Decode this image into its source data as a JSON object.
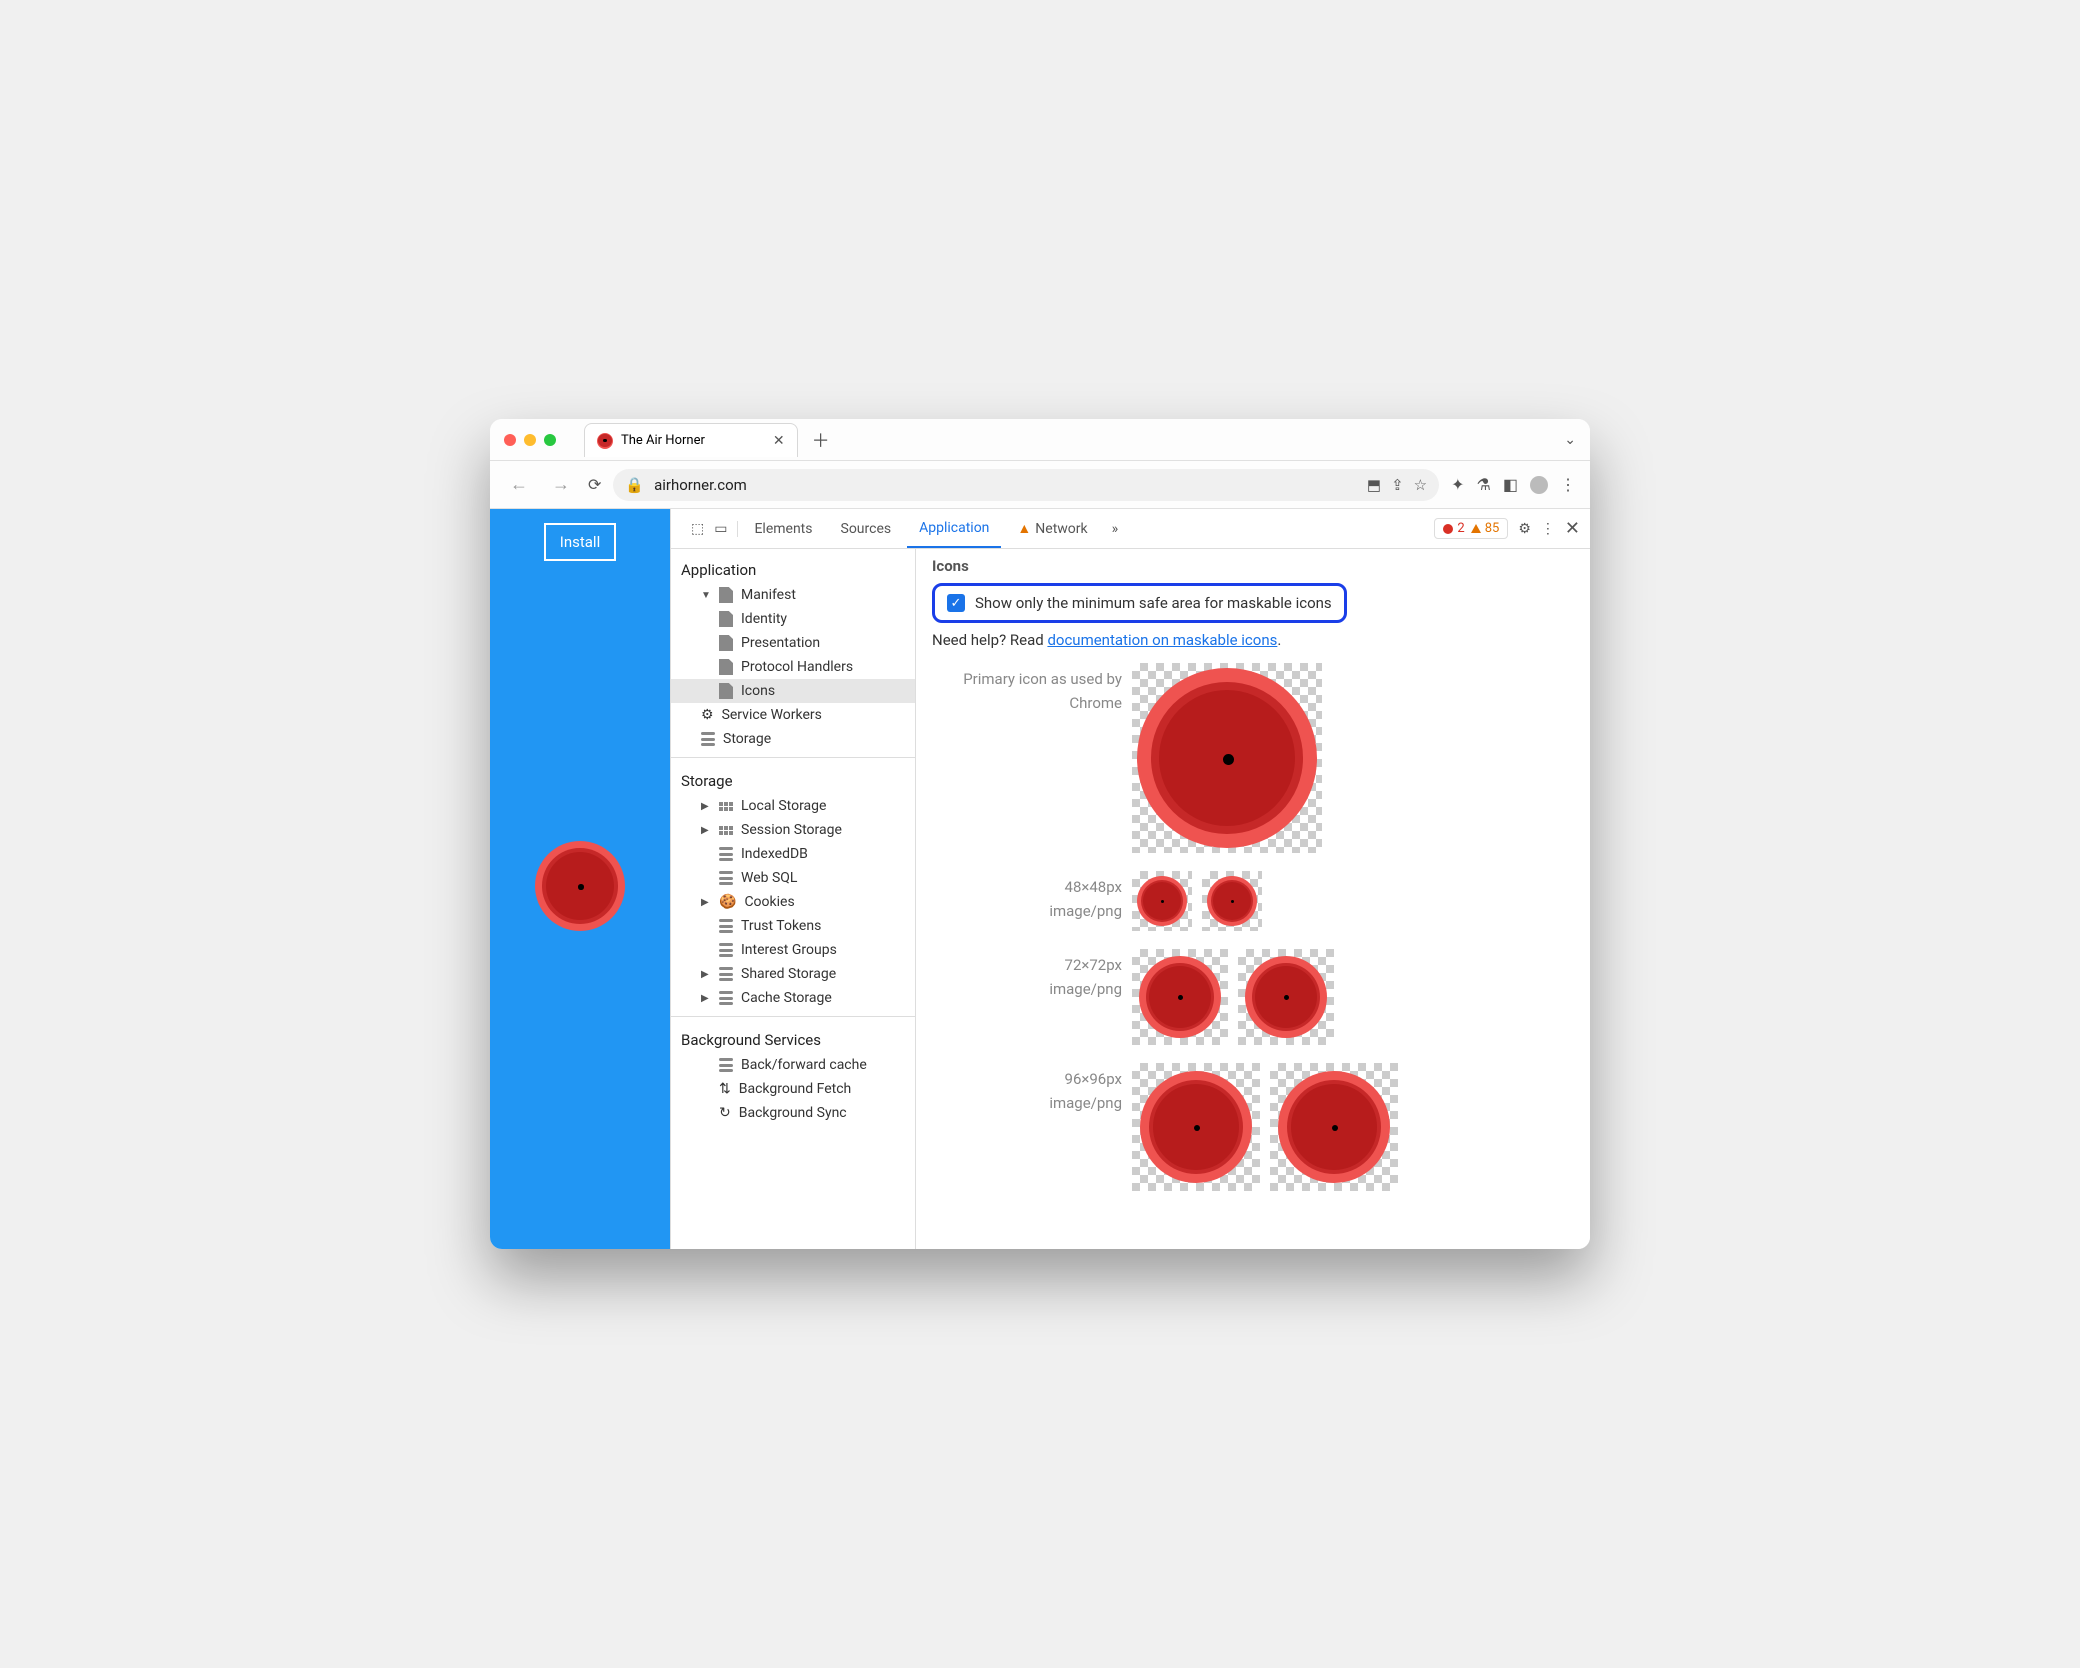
{
  "browser": {
    "tab_title": "The Air Horner",
    "url": "airhorner.com",
    "install_label": "Install"
  },
  "devtools": {
    "tabs": {
      "elements": "Elements",
      "sources": "Sources",
      "application": "Application",
      "network": "Network"
    },
    "issues": {
      "errors": "2",
      "warnings": "85"
    },
    "sidebar": {
      "application": "Application",
      "manifest": "Manifest",
      "identity": "Identity",
      "presentation": "Presentation",
      "protocol_handlers": "Protocol Handlers",
      "icons": "Icons",
      "service_workers": "Service Workers",
      "storage_app": "Storage",
      "storage": "Storage",
      "local_storage": "Local Storage",
      "session_storage": "Session Storage",
      "indexeddb": "IndexedDB",
      "websql": "Web SQL",
      "cookies": "Cookies",
      "trust_tokens": "Trust Tokens",
      "interest_groups": "Interest Groups",
      "shared_storage": "Shared Storage",
      "cache_storage": "Cache Storage",
      "bg_services": "Background Services",
      "back_fwd": "Back/forward cache",
      "bg_fetch": "Background Fetch",
      "bg_sync": "Background Sync"
    },
    "panel": {
      "heading": "Icons",
      "checkbox_label": "Show only the minimum safe area for maskable icons",
      "help_prefix": "Need help? Read ",
      "help_link": "documentation on maskable icons",
      "help_suffix": ".",
      "primary_label_l1": "Primary icon as used by",
      "primary_label_l2": "Chrome",
      "row48_size": "48×48px",
      "row48_type": "image/png",
      "row72_size": "72×72px",
      "row72_type": "image/png",
      "row96_size": "96×96px",
      "row96_type": "image/png"
    }
  }
}
